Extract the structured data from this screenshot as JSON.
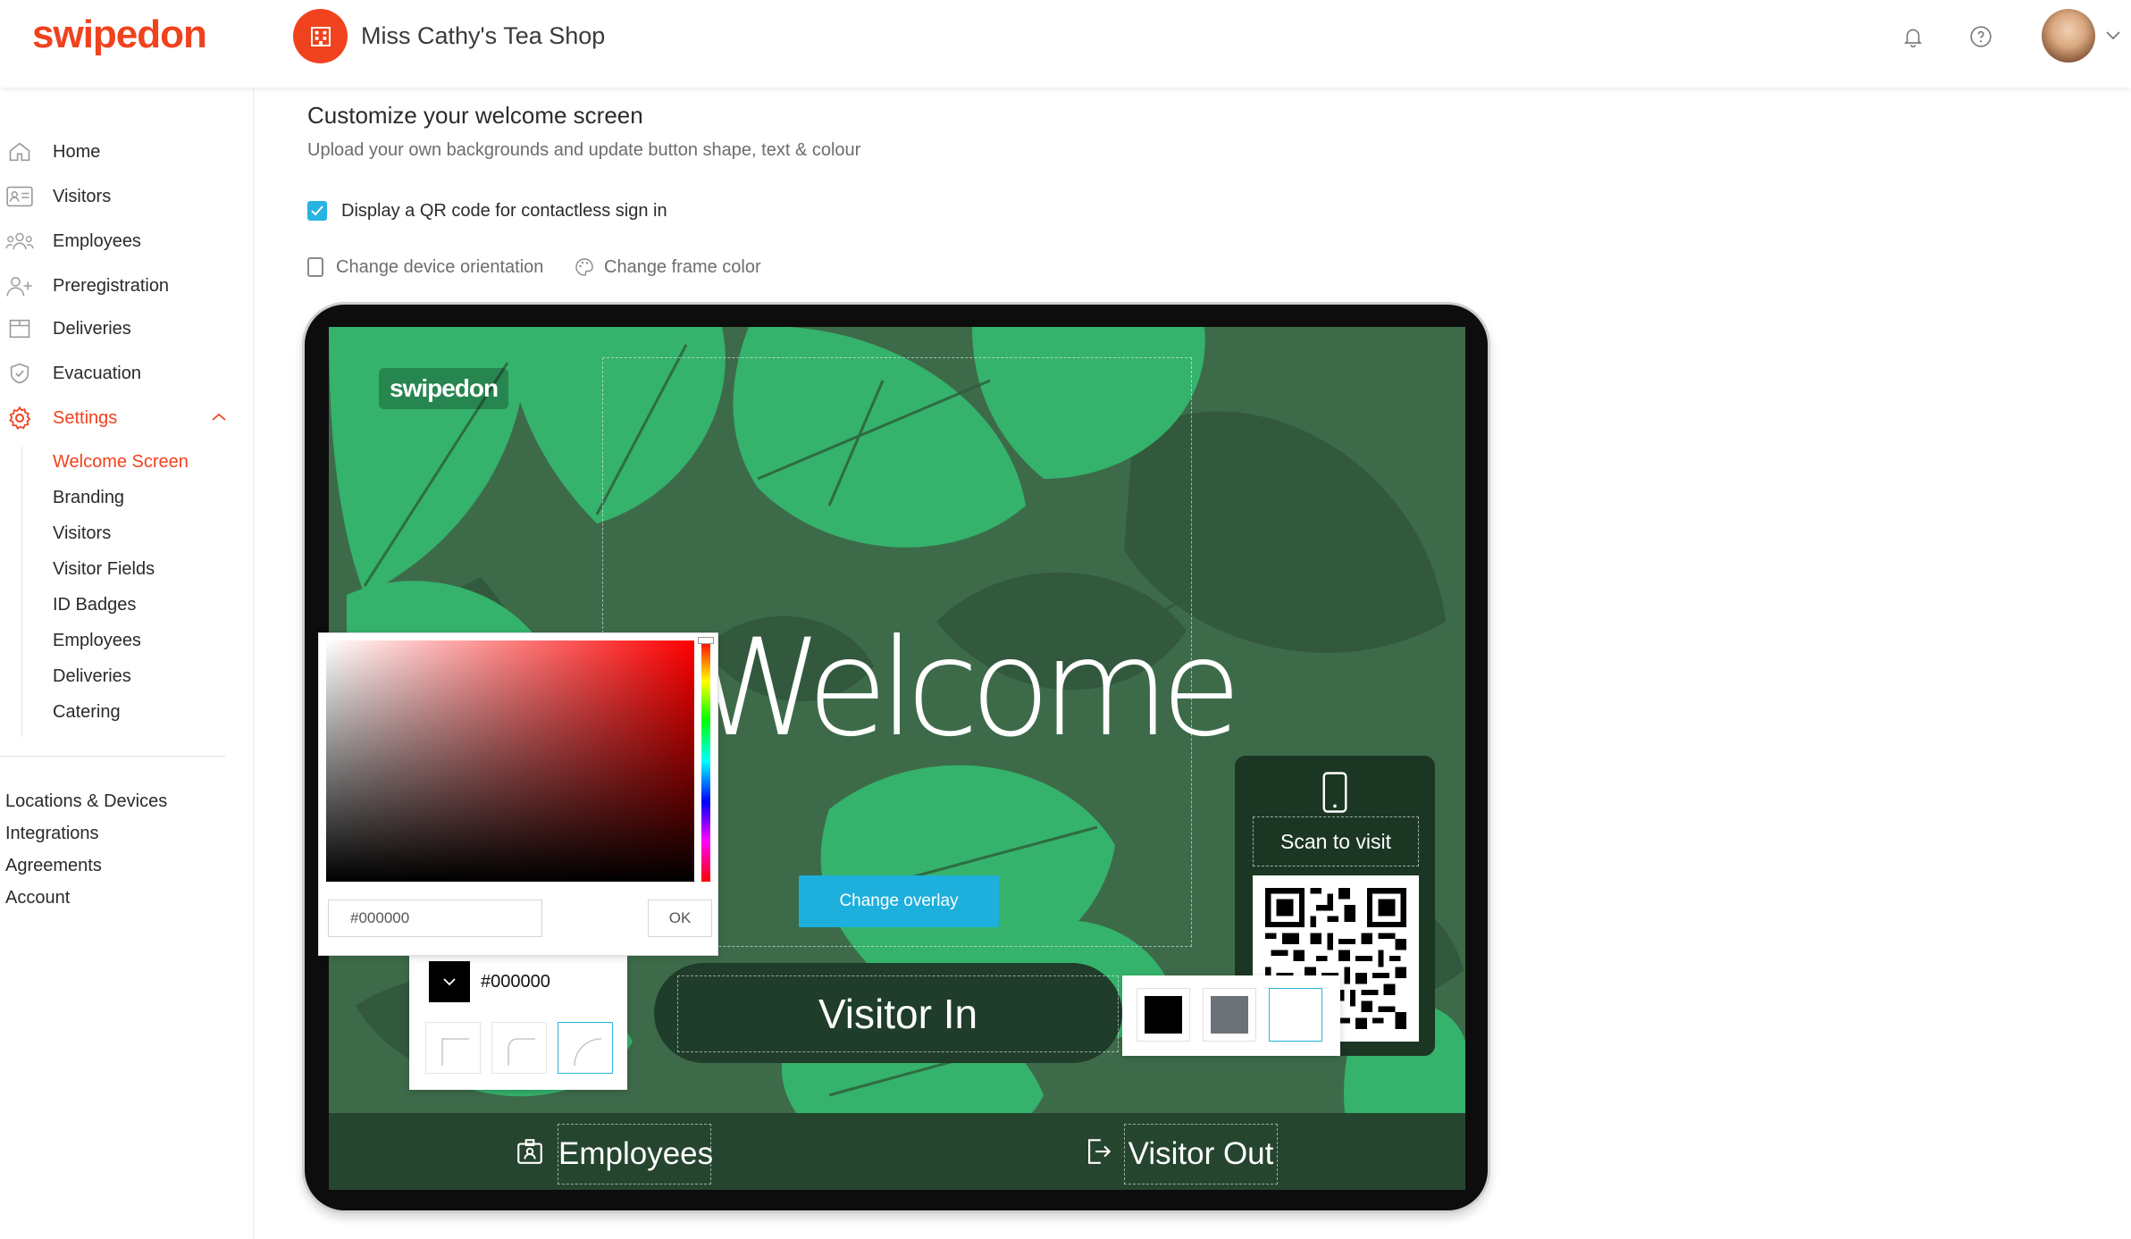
{
  "header": {
    "logo": "swipedon",
    "shop_name": "Miss Cathy's Tea Shop"
  },
  "icons": {
    "notifications": "bell-icon",
    "help": "question-icon",
    "account_menu": "chevron-down-icon"
  },
  "sidebar": {
    "items": [
      {
        "label": "Home",
        "icon": "home-icon"
      },
      {
        "label": "Visitors",
        "icon": "id-card-icon"
      },
      {
        "label": "Employees",
        "icon": "people-icon"
      },
      {
        "label": "Preregistration",
        "icon": "user-plus-icon"
      },
      {
        "label": "Deliveries",
        "icon": "box-icon"
      },
      {
        "label": "Evacuation",
        "icon": "shield-icon"
      },
      {
        "label": "Settings",
        "icon": "gear-icon",
        "active": true,
        "expanded": true
      }
    ],
    "settings_sub": [
      {
        "label": "Welcome Screen",
        "active": true
      },
      {
        "label": "Branding"
      },
      {
        "label": "Visitors"
      },
      {
        "label": "Visitor Fields"
      },
      {
        "label": "ID Badges"
      },
      {
        "label": "Employees"
      },
      {
        "label": "Deliveries"
      },
      {
        "label": "Catering"
      }
    ],
    "bottom_links": [
      "Locations & Devices",
      "Integrations",
      "Agreements",
      "Account"
    ]
  },
  "main": {
    "title": "Customize your welcome screen",
    "subtitle": "Upload your own backgrounds and update button shape, text & colour",
    "qr_option": {
      "label": "Display a QR code for contactless sign in",
      "checked": true
    },
    "orientation_label": "Change device orientation",
    "frame_color_label": "Change frame color"
  },
  "preview": {
    "logo": "swipedon",
    "welcome": "Welcome",
    "change_overlay": "Change overlay",
    "visitor_in": "Visitor In",
    "employees": "Employees",
    "visitor_out": "Visitor Out",
    "scan_to_visit": "Scan to visit"
  },
  "color_picker": {
    "hex_value": "#000000",
    "ok_label": "OK"
  },
  "button_style": {
    "color_hex": "#000000",
    "selected_shape": "rounded"
  },
  "text_color_options": [
    "#000000",
    "#6c7277",
    "#ffffff"
  ],
  "colors": {
    "brand": "#f0421e",
    "accent": "#26b5e0",
    "leaf_bg": "#3d6b4a"
  }
}
